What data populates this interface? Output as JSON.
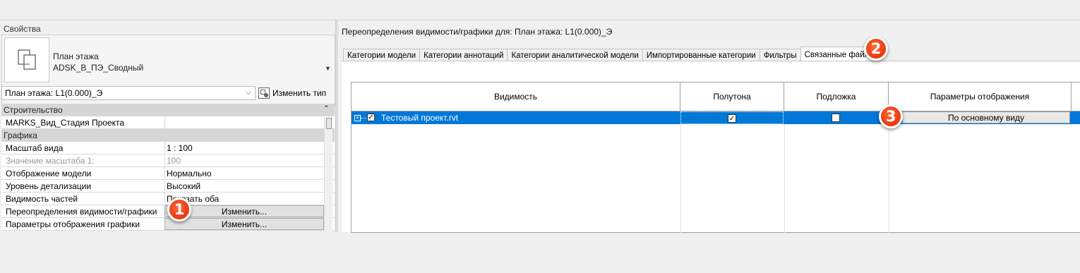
{
  "properties": {
    "title": "Свойства",
    "type_name_line1": "План этажа",
    "type_name_line2": "ADSK_В_ПЭ_Сводный",
    "selector_value": "План этажа: L1(0.000)_Э",
    "edit_type_label": "Изменить тип",
    "rows": [
      {
        "kind": "group",
        "key": "Строительство"
      },
      {
        "kind": "prop",
        "key": "MARKS_Вид_Стадия Проекта",
        "value": ""
      },
      {
        "kind": "group",
        "key": "Графика"
      },
      {
        "kind": "prop",
        "key": "Масштаб вида",
        "value": "1 : 100"
      },
      {
        "kind": "dim",
        "key": "Значение масштаба    1:",
        "value": "100"
      },
      {
        "kind": "prop",
        "key": "Отображение модели",
        "value": "Нормально"
      },
      {
        "kind": "prop",
        "key": "Уровень детализации",
        "value": "Высокий"
      },
      {
        "kind": "prop",
        "key": "Видимость частей",
        "value": "Показать оба"
      },
      {
        "kind": "button",
        "key": "Переопределения видимости/графики",
        "value": "Изменить..."
      },
      {
        "kind": "button",
        "key": "Параметры отображения графики",
        "value": "Изменить..."
      }
    ]
  },
  "dialog": {
    "title": "Переопределения видимости/графики для: План этажа: L1(0.000)_Э",
    "tabs": [
      "Категории модели",
      "Категории аннотаций",
      "Категории аналитической модели",
      "Импортированные категории",
      "Фильтры",
      "Связанные файлы"
    ],
    "active_tab_index": 5,
    "columns": [
      "Видимость",
      "Полутона",
      "Подложка",
      "Параметры отображения"
    ],
    "rows": [
      {
        "name": "Тестовый проект.rvt",
        "visible": true,
        "halftone": true,
        "underlay": false,
        "display": "По основному виду"
      }
    ]
  },
  "callouts": [
    "1",
    "2",
    "3"
  ],
  "colors": {
    "selection": "#0078d7",
    "callout": "#e8380d",
    "group_row": "#d6d6d6"
  }
}
